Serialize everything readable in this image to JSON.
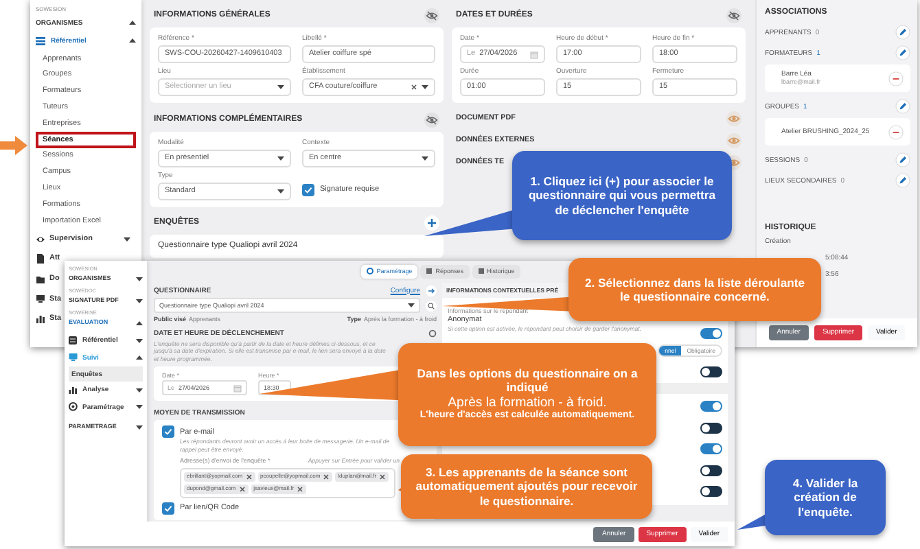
{
  "main_window": {
    "sidebar": {
      "brand": "SOWESION",
      "section": {
        "label": "ORGANISMES",
        "expanded": true
      },
      "group": {
        "label": "Référentiel",
        "expanded": true
      },
      "items": [
        {
          "label": "Apprenants",
          "selected": false
        },
        {
          "label": "Groupes",
          "selected": false
        },
        {
          "label": "Formateurs",
          "selected": false
        },
        {
          "label": "Tuteurs",
          "selected": false
        },
        {
          "label": "Entreprises",
          "selected": false
        },
        {
          "label": "Séances",
          "selected": true
        },
        {
          "label": "Sessions",
          "selected": false
        },
        {
          "label": "Campus",
          "selected": false
        },
        {
          "label": "Lieux",
          "selected": false
        },
        {
          "label": "Formations",
          "selected": false
        },
        {
          "label": "Importation Excel",
          "selected": false
        }
      ],
      "modules": [
        {
          "label": "Supervision",
          "expanded": false
        },
        {
          "label": "Att"
        },
        {
          "label": "Do"
        },
        {
          "label": "Sta"
        },
        {
          "label": "Sta"
        }
      ]
    },
    "general": {
      "title": "INFORMATIONS GÉNÉRALES",
      "fields": [
        {
          "kind": "text",
          "label": "Référence *",
          "value": "SWS-COU-20260427-1409610403"
        },
        {
          "kind": "text",
          "label": "Libellé *",
          "value": "Atelier coiffure spé"
        },
        {
          "kind": "select",
          "label": "Lieu",
          "placeholder": "Sélectionner un lieu"
        },
        {
          "kind": "select",
          "label": "Établissement",
          "value": "CFA couture/coiffure",
          "clearable": true
        }
      ]
    },
    "complementary": {
      "title": "INFORMATIONS COMPLÉMENTAIRES",
      "fields": [
        {
          "kind": "select",
          "label": "Modalité",
          "value": "En présentiel"
        },
        {
          "kind": "select",
          "label": "Contexte",
          "value": "En centre"
        },
        {
          "kind": "select",
          "label": "Type",
          "value": "Standard"
        },
        {
          "kind": "checkbox",
          "label": "Signature requise",
          "checked": true
        }
      ]
    },
    "surveys": {
      "title": "ENQUÊTES",
      "items": [
        "Questionnaire type Qualiopi avril 2024"
      ]
    },
    "dates": {
      "title": "DATES ET DURÉES",
      "fields": [
        {
          "kind": "date",
          "label": "Date *",
          "prefix": "Le",
          "value": "27/04/2026"
        },
        {
          "kind": "text",
          "label": "Heure de début *",
          "value": "17:00"
        },
        {
          "kind": "text",
          "label": "Heure de fin *",
          "value": "18:00"
        },
        {
          "kind": "text",
          "label": "Durée",
          "value": "01:00"
        },
        {
          "kind": "text",
          "label": "Ouverture",
          "value": "15"
        },
        {
          "kind": "text",
          "label": "Fermeture",
          "value": "15"
        }
      ]
    },
    "sections": [
      {
        "title": "DOCUMENT PDF"
      },
      {
        "title": "DONNÉES EXTERNES"
      },
      {
        "title": "DONNÉES TE"
      }
    ],
    "associations": {
      "title": "ASSOCIATIONS",
      "groups": [
        {
          "label": "APPRENANTS",
          "count": "0"
        },
        {
          "label": "FORMATEURS",
          "count": "1",
          "entries": [
            {
              "name": "Barre Léa",
              "email": "lbarre@mail.fr"
            }
          ]
        },
        {
          "label": "GROUPES",
          "count": "1",
          "entries": [
            {
              "name": "Atelier BRUSHING_2024_25"
            }
          ]
        },
        {
          "label": "SESSIONS",
          "count": "0"
        },
        {
          "label": "LIEUX SECONDAIRES",
          "count": "0"
        }
      ]
    },
    "history": {
      "title": "HISTORIQUE",
      "label": "Création",
      "lines": [
        "5:08:44",
        "3:56"
      ]
    },
    "buttons": [
      {
        "label": "Annuler",
        "kind": "secondary"
      },
      {
        "label": "Supprimer",
        "kind": "danger"
      },
      {
        "label": "Valider",
        "kind": "light"
      }
    ]
  },
  "survey_window": {
    "sidebar": {
      "sections": [
        {
          "brand": "SOWESION",
          "label": "ORGANISMES",
          "expanded": false
        },
        {
          "brand": "SOWEDOC",
          "label": "SIGNATURE PDF",
          "expanded": false
        },
        {
          "brand": "SOWERISE",
          "label": "EVALUATION",
          "expanded": true
        }
      ],
      "groups": [
        {
          "label": "Référentiel",
          "expanded": false
        },
        {
          "label": "Suivi",
          "expanded": true,
          "items": [
            {
              "label": "Enquêtes",
              "selected": true
            }
          ]
        },
        {
          "label": "Analyse",
          "expanded": false
        },
        {
          "label": "Paramétrage",
          "expanded": false
        }
      ],
      "footer_section": {
        "label": "PARAMETRAGE",
        "expanded": false
      }
    },
    "tabs": [
      {
        "label": "Paramétrage",
        "selected": true
      },
      {
        "label": "Réponses",
        "selected": false
      },
      {
        "label": "Historique",
        "selected": false
      }
    ],
    "questionnaire": {
      "title": "QUESTIONNAIRE",
      "link": "Configure",
      "value": "Questionnaire type Qualiopi avril 2024",
      "audience_label": "Public visé",
      "audience": "Apprenants",
      "type_label": "Type",
      "type": "Après la formation - à froid"
    },
    "trigger": {
      "title": "DATE ET HEURE DE DÉCLENCHEMENT",
      "note": "L'enquête ne sera disponible qu'à partir de la date et heure définies ci-dessous, et ce jusqu'à sa date d'expiration. Si elle est transmise par e-mail, le lien sera envoyé à la date et heure programmée.",
      "date_label": "Date *",
      "date_prefix": "Le",
      "date": "27/04/2026",
      "time_label": "Heure *",
      "time": "18:30"
    },
    "transmission": {
      "title": "MOYEN DE TRANSMISSION",
      "options": [
        {
          "label": "Par e-mail",
          "checked": true,
          "note": "Les répondants devront avoir un accès à leur boite de messagerie. Un e-mail de rappel peut être envoyé."
        },
        {
          "label": "Par lien/QR Code",
          "checked": true
        }
      ],
      "address_label": "Adresse(s) d'envoi de l'enquête *",
      "address_hint": "Appuyer sur Entrée pour valider un",
      "addresses": [
        "ebrillant@yopmail.com",
        "pcoupelle@yopmail.com",
        "lduplan@mail.fr",
        "dupond@gmail.com",
        "jsavieux@mail.fr"
      ]
    },
    "context": {
      "title": "INFORMATIONS CONTEXTUELLES PRÉ",
      "subtitle": "Informations sur le répondant",
      "anonymity": {
        "label": "Anonymat",
        "note": "Si cette option est activée, le répondant peut choisir de garder l'anonymat.",
        "on": true
      },
      "mode": [
        {
          "label": "nnel",
          "selected": true
        },
        {
          "label": "Obligatoire",
          "selected": false
        }
      ],
      "toggles": [
        {
          "on": false
        },
        {
          "on": true
        },
        {
          "on": false
        },
        {
          "on": true
        },
        {
          "on": false
        },
        {
          "on": false
        }
      ]
    },
    "buttons": [
      {
        "label": "Annuler",
        "kind": "secondary"
      },
      {
        "label": "Supprimer",
        "kind": "danger"
      },
      {
        "label": "Valider",
        "kind": "light"
      }
    ]
  },
  "callouts": [
    {
      "color": "#3a64c6",
      "lines": [
        {
          "kind": "heading",
          "text": "1. Cliquez ici (+) pour associer le questionnaire qui vous permettra de déclencher l'enquête"
        }
      ]
    },
    {
      "color": "#ec7a2c",
      "lines": [
        {
          "kind": "heading",
          "text": "2. Sélectionnez dans la liste déroulante le questionnaire concerné."
        }
      ]
    },
    {
      "color": "#ec7a2c",
      "lines": [
        {
          "kind": "heading",
          "text": "Dans les options du questionnaire on a indiqué"
        },
        {
          "kind": "plain",
          "text": "Après la formation - à froid."
        },
        {
          "kind": "note",
          "text": "L'heure d'accès est calculée automatiquement."
        }
      ]
    },
    {
      "color": "#ec7a2c",
      "lines": [
        {
          "kind": "heading",
          "text": "3. Les apprenants de la séance sont automatiquement ajoutés pour recevoir le questionnaire."
        }
      ]
    },
    {
      "color": "#3a64c6",
      "lines": [
        {
          "kind": "heading",
          "text": "4. Valider la création de l'enquête."
        }
      ]
    }
  ]
}
